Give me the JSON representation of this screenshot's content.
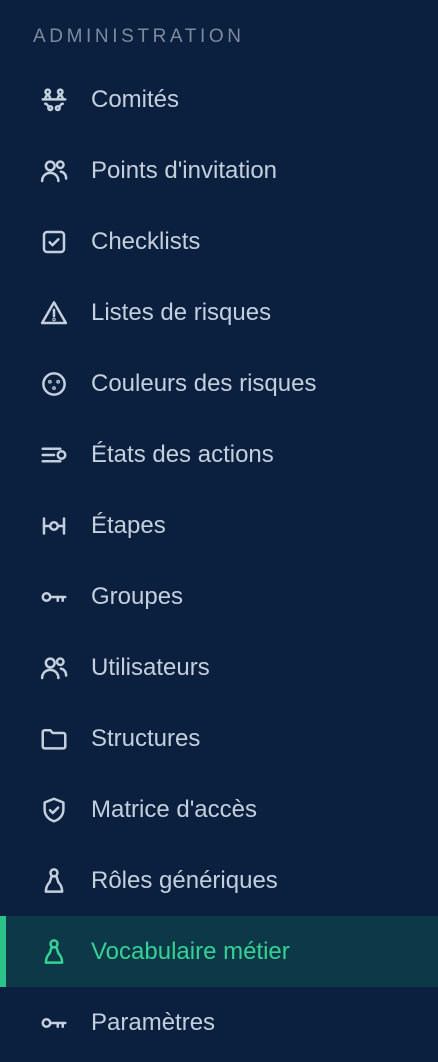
{
  "section": {
    "title": "ADMINISTRATION"
  },
  "menu": {
    "items": [
      {
        "label": "Comités",
        "icon": "meeting-table-icon"
      },
      {
        "label": "Points d'invitation",
        "icon": "users-icon"
      },
      {
        "label": "Checklists",
        "icon": "checkbox-icon"
      },
      {
        "label": "Listes de risques",
        "icon": "warning-triangle-icon"
      },
      {
        "label": "Couleurs des risques",
        "icon": "palette-icon"
      },
      {
        "label": "États des actions",
        "icon": "list-toggle-icon"
      },
      {
        "label": "Étapes",
        "icon": "workflow-steps-icon"
      },
      {
        "label": "Groupes",
        "icon": "key-icon"
      },
      {
        "label": "Utilisateurs",
        "icon": "users-icon"
      },
      {
        "label": "Structures",
        "icon": "folder-icon"
      },
      {
        "label": "Matrice d'accès",
        "icon": "shield-check-icon"
      },
      {
        "label": "Rôles génériques",
        "icon": "person-icon"
      },
      {
        "label": "Vocabulaire métier",
        "icon": "person-icon",
        "active": true
      },
      {
        "label": "Paramètres",
        "icon": "key-icon"
      }
    ]
  },
  "colors": {
    "background": "#0b1f3e",
    "text": "#c4cfdd",
    "section_title": "#7d8aa0",
    "active_background": "#0c3848",
    "active_accent": "#2cc38a"
  }
}
